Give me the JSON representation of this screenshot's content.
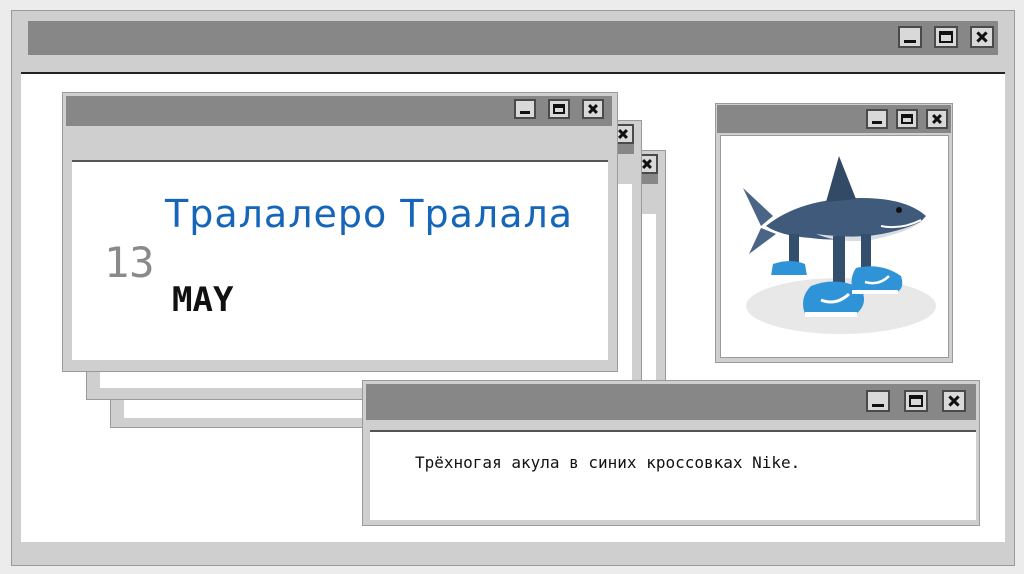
{
  "slide": {
    "title": "Тралалеро Тралала",
    "date_day": "13",
    "date_month": "MAY",
    "caption": "Трёхногая акула в синих кроссовках Nike."
  },
  "image": {
    "subject": "shark-with-legs-in-blue-sneakers",
    "colors": {
      "sneaker": "#2f93d8",
      "shark_body": "#3f5a7a",
      "belly": "#d8dde3"
    }
  },
  "colors": {
    "title_accent": "#1565b9",
    "titlebar": "#878787",
    "frame": "#cfcfcf",
    "window_bg": "#ffffff"
  },
  "icons": {
    "minimize": "minimize-icon",
    "maximize": "maximize-icon",
    "close": "close-icon"
  }
}
